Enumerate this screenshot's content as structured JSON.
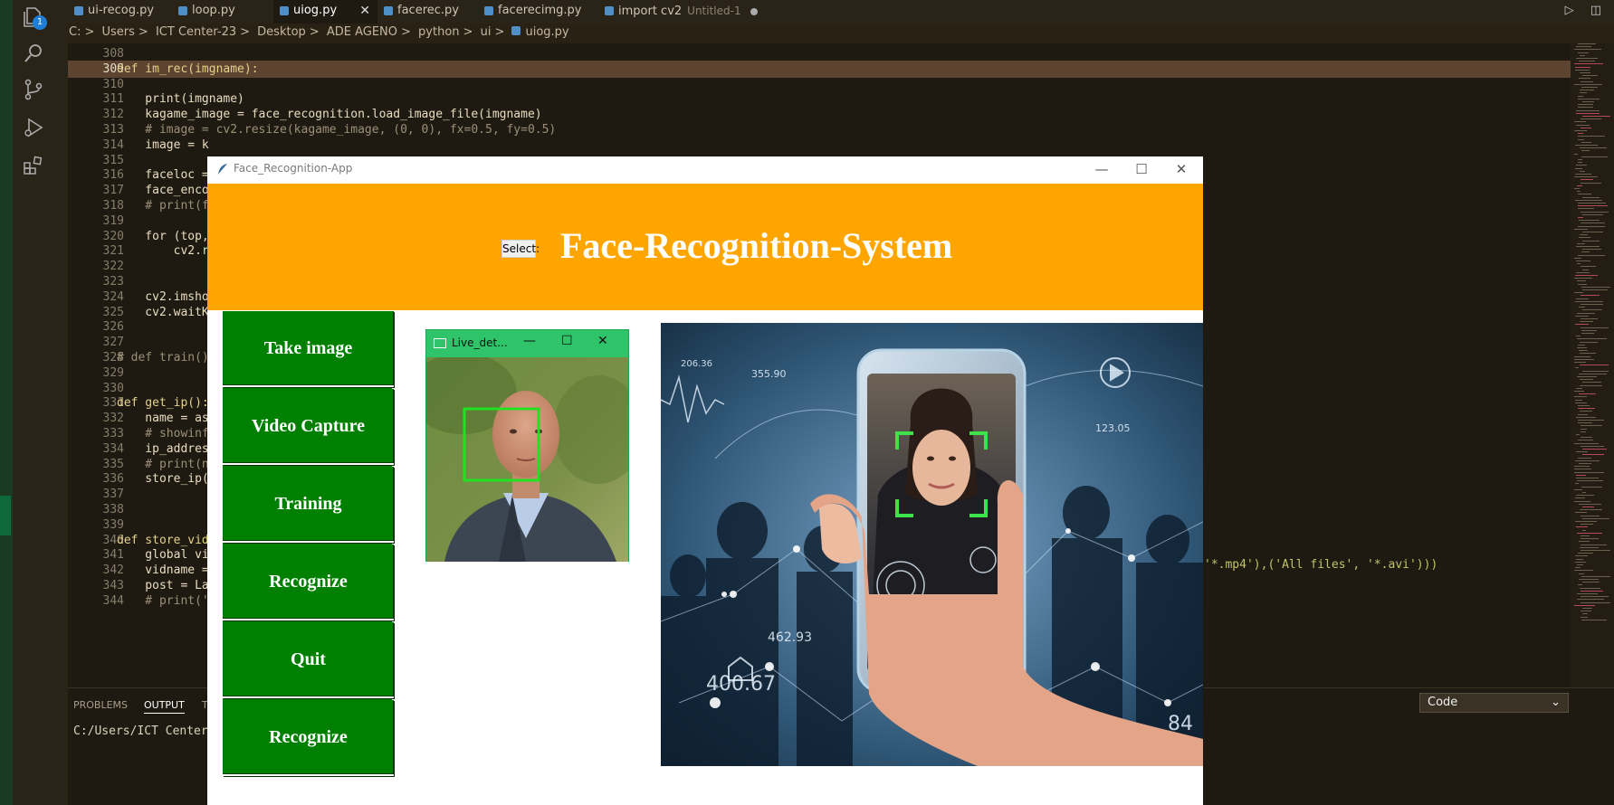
{
  "vscode": {
    "tabs": [
      {
        "label": "ui-recog.py",
        "active": false
      },
      {
        "label": "loop.py",
        "active": false
      },
      {
        "label": "uiog.py",
        "active": true
      },
      {
        "label": "facerec.py",
        "active": false
      },
      {
        "label": "facerecimg.py",
        "active": false
      },
      {
        "label": "import cv2",
        "active": false
      }
    ],
    "untitled_tag": "Untitled-1",
    "activity_badge": "1",
    "breadcrumb": [
      "C:",
      ">",
      "Users",
      ">",
      "ICT Center-23",
      ">",
      "Desktop",
      ">",
      "ADE AGENO",
      ">",
      "python",
      ">",
      "ui",
      ">",
      "uiog.py"
    ],
    "panel": {
      "tabs": [
        "PROBLEMS",
        "OUTPUT",
        "T"
      ],
      "output_text": "C:/Users/ICT Center",
      "output_channel": "Code"
    },
    "code_lines": [
      {
        "n": "308",
        "t": ""
      },
      {
        "n": "309",
        "t": "def im_rec(imgname):"
      },
      {
        "n": "310",
        "t": ""
      },
      {
        "n": "311",
        "t": "    print(imgname)"
      },
      {
        "n": "312",
        "t": "    kagame_image = face_recognition.load_image_file(imgname)"
      },
      {
        "n": "313",
        "t": "    # image = cv2.resize(kagame_image, (0, 0), fx=0.5, fy=0.5)"
      },
      {
        "n": "314",
        "t": "    image = k"
      },
      {
        "n": "315",
        "t": ""
      },
      {
        "n": "316",
        "t": "    faceloc ="
      },
      {
        "n": "317",
        "t": "    face_enco"
      },
      {
        "n": "318",
        "t": "    # print(f"
      },
      {
        "n": "319",
        "t": ""
      },
      {
        "n": "320",
        "t": "    for (top,"
      },
      {
        "n": "321",
        "t": "        cv2.r"
      },
      {
        "n": "322",
        "t": ""
      },
      {
        "n": "323",
        "t": ""
      },
      {
        "n": "324",
        "t": "    cv2.imsho"
      },
      {
        "n": "325",
        "t": "    cv2.waitK"
      },
      {
        "n": "326",
        "t": ""
      },
      {
        "n": "327",
        "t": ""
      },
      {
        "n": "328",
        "t": "# def train()"
      },
      {
        "n": "329",
        "t": ""
      },
      {
        "n": "330",
        "t": ""
      },
      {
        "n": "331",
        "t": "def get_ip():"
      },
      {
        "n": "332",
        "t": "    name = as"
      },
      {
        "n": "333",
        "t": "    # showinf"
      },
      {
        "n": "334",
        "t": "    ip_addres"
      },
      {
        "n": "335",
        "t": "    # print(n"
      },
      {
        "n": "336",
        "t": "    store_ip("
      },
      {
        "n": "337",
        "t": ""
      },
      {
        "n": "338",
        "t": ""
      },
      {
        "n": "339",
        "t": ""
      },
      {
        "n": "340",
        "t": "def store_vid"
      },
      {
        "n": "341",
        "t": "    global vi"
      },
      {
        "n": "342",
        "t": "    vidname ="
      },
      {
        "n": "343",
        "t": "    post = La"
      },
      {
        "n": "344",
        "t": "    # print('"
      }
    ],
    "code_tail_342": "'*.mp4'),('All files', '*.avi')))"
  },
  "app": {
    "window_title": "Face_Recognition-App",
    "select_label": "Select:",
    "heading": "Face-Recognition-System",
    "menu_buttons": [
      "Take image",
      "Video Capture",
      "Training",
      "Recognize",
      "Quit",
      "Recognize"
    ],
    "live_window_title": "Live_det...",
    "colors": {
      "header": "#ffa500",
      "menu": "#008000",
      "face_box": "#22e022"
    }
  },
  "hero_overlay_numbers": [
    "206.36",
    "355.90",
    "123.05",
    "462.93",
    "400.67",
    "84"
  ]
}
